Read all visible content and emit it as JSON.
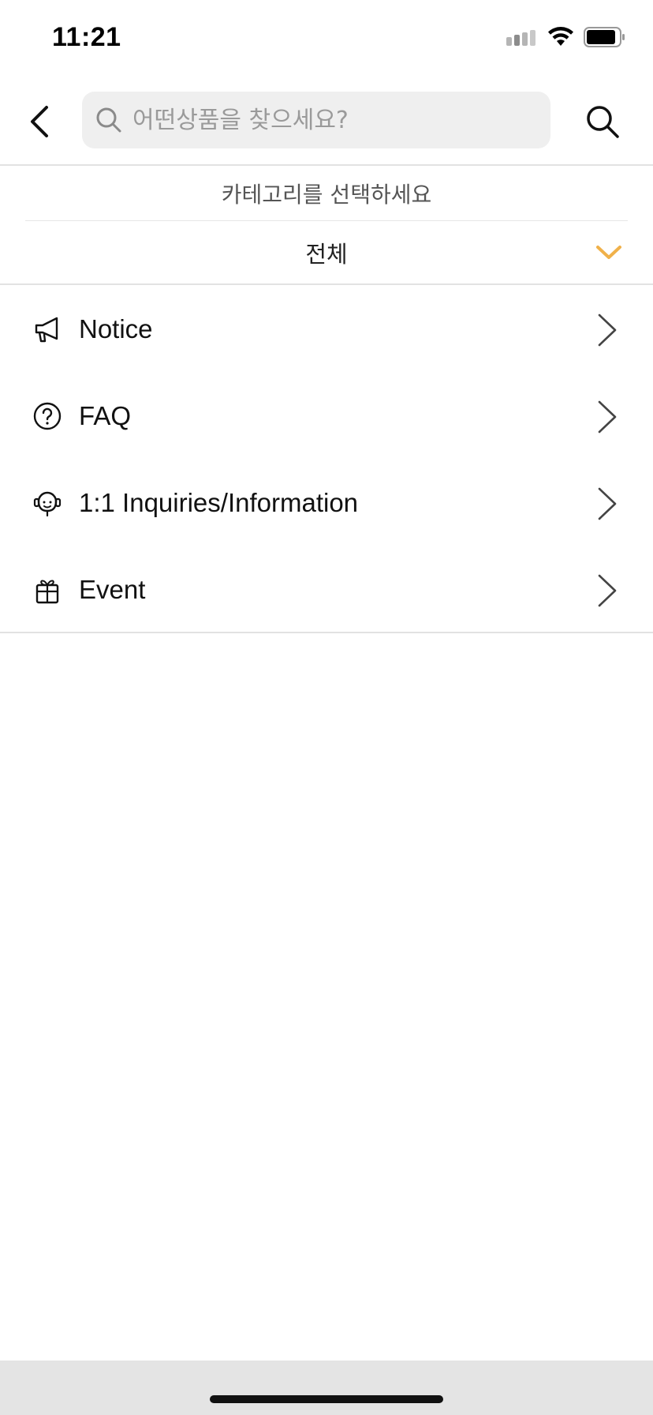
{
  "status_bar": {
    "time": "11:21"
  },
  "header": {
    "search": {
      "placeholder": "어떤상품을 찾으세요?",
      "value": ""
    }
  },
  "category": {
    "caption": "카테고리를 선택하세요",
    "selected": "전체",
    "accent_color": "#f0b14a"
  },
  "menu": {
    "items": [
      {
        "label": "Notice",
        "icon": "megaphone-icon"
      },
      {
        "label": "FAQ",
        "icon": "question-circle-icon"
      },
      {
        "label": "1:1 Inquiries/Information",
        "icon": "headset-icon"
      },
      {
        "label": "Event",
        "icon": "gift-icon"
      }
    ]
  }
}
